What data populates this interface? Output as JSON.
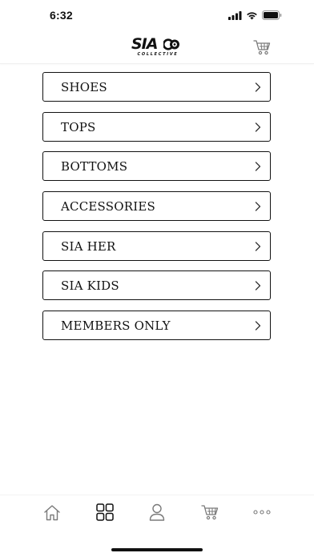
{
  "status_bar": {
    "time": "6:32"
  },
  "brand": {
    "name": "SIA",
    "tagline": "COLLECTIVE"
  },
  "icons": {
    "header_cart": "cart-icon",
    "chevron": "chevron-right-icon",
    "tabs": [
      "home-icon",
      "grid-icon",
      "profile-icon",
      "cart-icon",
      "more-icon"
    ]
  },
  "categories": [
    {
      "label": "SHOES"
    },
    {
      "label": "TOPS"
    },
    {
      "label": "BOTTOMS"
    },
    {
      "label": "ACCESSORIES"
    },
    {
      "label": "SIA HER"
    },
    {
      "label": "SIA KIDS"
    },
    {
      "label": "MEMBERS ONLY"
    }
  ],
  "tab_bar": {
    "active_tab": "categories"
  },
  "colors": {
    "text": "#111111",
    "border": "#111111",
    "icon_muted": "#7a7a7a",
    "background": "#ffffff"
  }
}
